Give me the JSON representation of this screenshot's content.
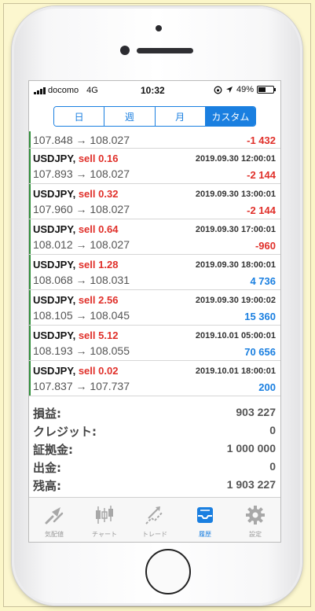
{
  "status": {
    "carrier": "docomo",
    "network": "4G",
    "time": "10:32",
    "battery": "49%",
    "battery_level": 0.49
  },
  "segments": [
    {
      "label": "日",
      "active": false
    },
    {
      "label": "週",
      "active": false
    },
    {
      "label": "月",
      "active": false
    },
    {
      "label": "カスタム",
      "active": true
    }
  ],
  "trades": [
    {
      "symbol": "",
      "side": "",
      "date": "",
      "prices": "107.848 → 108.027",
      "profit": "-1 432",
      "sign": "neg",
      "partial": true
    },
    {
      "symbol": "USDJPY,",
      "side": "sell 0.16",
      "date": "2019.09.30 12:00:01",
      "prices": "107.893 → 108.027",
      "profit": "-2 144",
      "sign": "neg"
    },
    {
      "symbol": "USDJPY,",
      "side": "sell 0.32",
      "date": "2019.09.30 13:00:01",
      "prices": "107.960 → 108.027",
      "profit": "-2 144",
      "sign": "neg"
    },
    {
      "symbol": "USDJPY,",
      "side": "sell 0.64",
      "date": "2019.09.30 17:00:01",
      "prices": "108.012 → 108.027",
      "profit": "-960",
      "sign": "neg"
    },
    {
      "symbol": "USDJPY,",
      "side": "sell 1.28",
      "date": "2019.09.30 18:00:01",
      "prices": "108.068 → 108.031",
      "profit": "4 736",
      "sign": "pos"
    },
    {
      "symbol": "USDJPY,",
      "side": "sell 2.56",
      "date": "2019.09.30 19:00:02",
      "prices": "108.105 → 108.045",
      "profit": "15 360",
      "sign": "pos"
    },
    {
      "symbol": "USDJPY,",
      "side": "sell 5.12",
      "date": "2019.10.01 05:00:01",
      "prices": "108.193 → 108.055",
      "profit": "70 656",
      "sign": "pos"
    },
    {
      "symbol": "USDJPY,",
      "side": "sell 0.02",
      "date": "2019.10.01 18:00:01",
      "prices": "107.837 → 107.737",
      "profit": "200",
      "sign": "pos"
    }
  ],
  "summary": [
    {
      "label": "損益:",
      "value": "903 227"
    },
    {
      "label": "クレジット:",
      "value": "0"
    },
    {
      "label": "証拠金:",
      "value": "1 000 000"
    },
    {
      "label": "出金:",
      "value": "0"
    },
    {
      "label": "残高:",
      "value": "1 903 227"
    }
  ],
  "tabs": [
    {
      "label": "気配値",
      "icon": "quotes-icon",
      "active": false
    },
    {
      "label": "チャート",
      "icon": "chart-icon",
      "active": false
    },
    {
      "label": "トレード",
      "icon": "trade-icon",
      "active": false
    },
    {
      "label": "履歴",
      "icon": "history-inbox-icon",
      "active": true
    },
    {
      "label": "設定",
      "icon": "gear-icon",
      "active": false
    }
  ],
  "colors": {
    "accent": "#1a7fe0",
    "loss": "#e0302a",
    "profit": "#1a7fe0",
    "row_marker": "#2f8f3a"
  }
}
